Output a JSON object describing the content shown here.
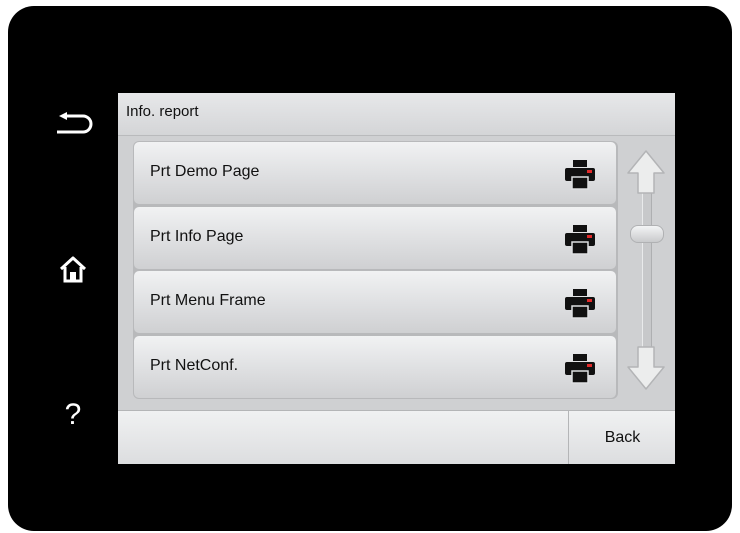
{
  "side_buttons": [
    {
      "name": "back-arrow-icon"
    },
    {
      "name": "home-icon"
    },
    {
      "name": "help-icon",
      "label": "?"
    }
  ],
  "screen": {
    "title": "Info. report",
    "items": [
      {
        "label": "Prt Demo Page",
        "icon": "printer-icon"
      },
      {
        "label": "Prt Info Page",
        "icon": "printer-icon"
      },
      {
        "label": "Prt Menu Frame",
        "icon": "printer-icon"
      },
      {
        "label": "Prt NetConf.",
        "icon": "printer-icon"
      }
    ],
    "scrollbar": {
      "up_icon": "scroll-up-arrow-icon",
      "down_icon": "scroll-down-arrow-icon",
      "position": 0
    },
    "back_label": "Back"
  },
  "colors": {
    "bezel": "#000000",
    "screen": "#cfd0d2",
    "item": "#dedfe1"
  }
}
